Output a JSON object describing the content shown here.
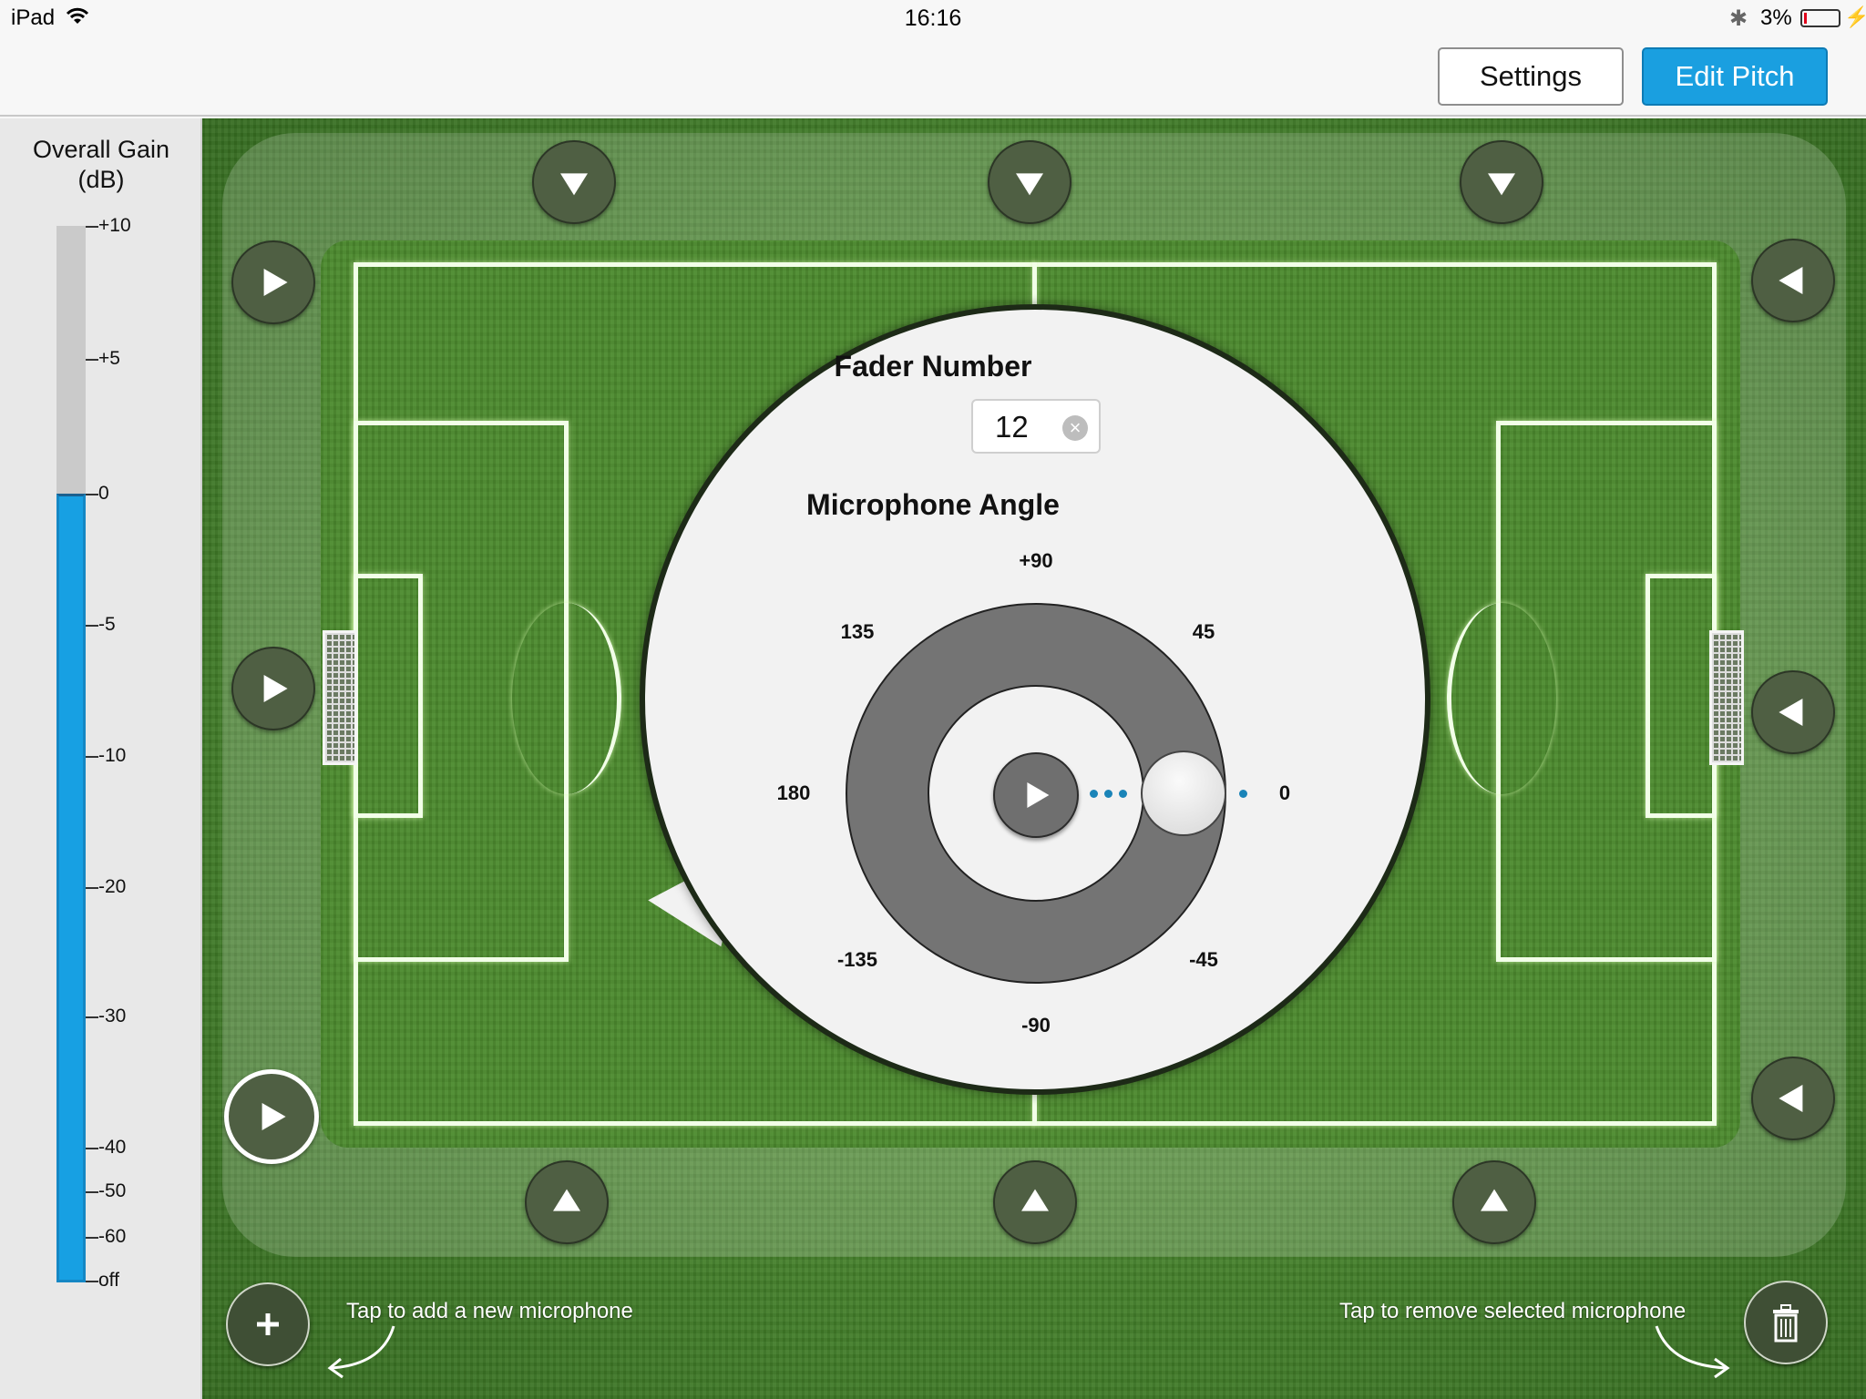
{
  "status_bar": {
    "device": "iPad",
    "time": "16:16",
    "battery": "3%",
    "battery_level": 0.03
  },
  "toolbar": {
    "settings_label": "Settings",
    "edit_pitch_label": "Edit Pitch"
  },
  "gain": {
    "title_line1": "Overall Gain",
    "title_line2": "(dB)",
    "current_db": 0,
    "ticks": [
      "+10",
      "+5",
      "0",
      "-5",
      "-10",
      "-20",
      "-30",
      "-40",
      "-50",
      "-60",
      "off"
    ]
  },
  "popover": {
    "fader_title": "Fader Number",
    "fader_value": "12",
    "angle_title": "Microphone Angle",
    "angle_labels": {
      "p90": "+90",
      "p135": "135",
      "p45": "45",
      "p180": "180",
      "p0": "0",
      "n135": "-135",
      "n45": "-45",
      "n90": "-90"
    },
    "current_angle": 0
  },
  "hints": {
    "add": "Tap to add a new microphone",
    "remove": "Tap to remove selected microphone"
  },
  "icons": {
    "add": "plus-icon",
    "remove": "trash-icon",
    "clear": "clear-icon"
  },
  "colors": {
    "accent": "#1a9fe0",
    "gain_fill": "#17a0e3",
    "pitch": "#4c8a2e"
  }
}
